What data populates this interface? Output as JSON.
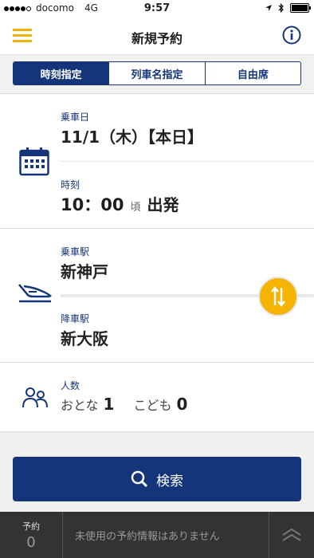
{
  "status_bar": {
    "carrier": "docomo",
    "network": "4G",
    "time": "9:57"
  },
  "header": {
    "title": "新規予約",
    "menu_icon": "hamburger-icon",
    "info_icon": "info-icon",
    "accent_color": "#f0b400"
  },
  "tabs": [
    {
      "label": "時刻指定",
      "selected": true
    },
    {
      "label": "列車名指定",
      "selected": false
    },
    {
      "label": "自由席",
      "selected": false
    }
  ],
  "date_time": {
    "date_label": "乗車日",
    "date_value": "11/1（木）【本日】",
    "time_label": "時刻",
    "time_value": "10：00",
    "time_suffix": "頃",
    "departure": "出発"
  },
  "stations": {
    "from_label": "乗車駅",
    "from_value": "新神戸",
    "to_label": "降車駅",
    "to_value": "新大阪",
    "swap_color": "#f5b400"
  },
  "people": {
    "label": "人数",
    "adult_label": "おとな",
    "adult_count": "1",
    "child_label": "こども",
    "child_count": "0"
  },
  "search_button": {
    "label": "検索",
    "color": "#15357a"
  },
  "bottom_bar": {
    "reservation_label": "予約",
    "reservation_count": "0",
    "message": "未使用の予約情報はありません"
  }
}
